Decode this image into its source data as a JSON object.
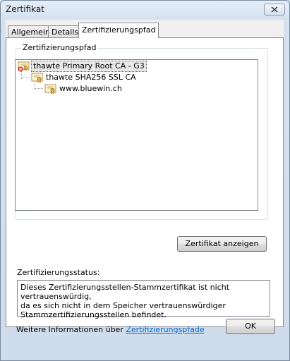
{
  "window": {
    "title": "Zertifikat"
  },
  "tabs": [
    {
      "label": "Allgemein"
    },
    {
      "label": "Details"
    },
    {
      "label": "Zertifizierungspfad"
    }
  ],
  "path_group": {
    "label": "Zertifizierungspfad",
    "tree": [
      {
        "label": "thawte Primary Root CA - G3",
        "level": 0,
        "status": "error",
        "selected": true
      },
      {
        "label": "thawte SHA256 SSL CA",
        "level": 1,
        "status": "ok",
        "selected": false
      },
      {
        "label": "www.bluewin.ch",
        "level": 2,
        "status": "ok",
        "selected": false
      }
    ],
    "view_button": "Zertifikat anzeigen"
  },
  "status": {
    "label": "Zertifizierungsstatus:",
    "text": "Dieses Zertifizierungsstellen-Stammzertifikat ist nicht vertrauenswürdig,\nda es sich nicht in dem Speicher vertrauenswürdiger\nStammzertifizierungsstellen befindet."
  },
  "more_info": {
    "prefix": "Weitere Informationen über",
    "link": "Zertifizierungspfade"
  },
  "ok_button": "OK",
  "colors": {
    "link": "#0066cc",
    "error_badge": "#cc2222",
    "cert_gold": "#e5b84a"
  }
}
